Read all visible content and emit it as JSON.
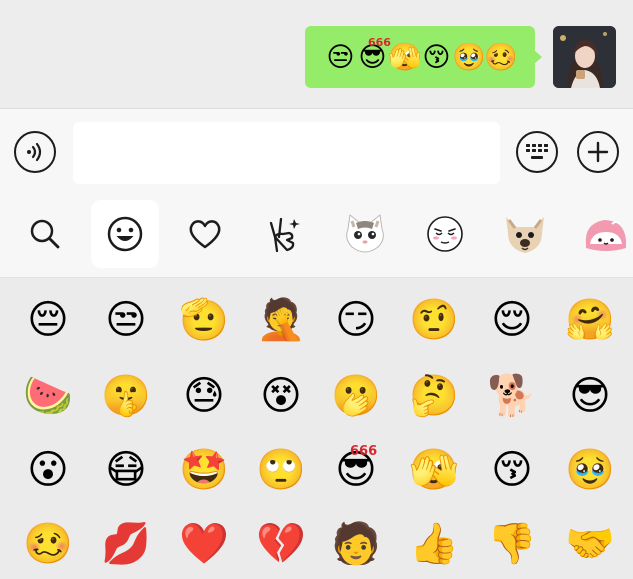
{
  "chat": {
    "message_emojis": [
      "😒",
      "😎",
      "🫣",
      "😚",
      "🥹",
      "🥴"
    ],
    "bubble_color": "#95ec69",
    "message_badge": "666"
  },
  "input_bar": {
    "voice_icon": "voice-icon",
    "text_value": "",
    "keyboard_icon": "keyboard-icon",
    "plus_icon": "plus-icon"
  },
  "tabs": [
    {
      "name": "search",
      "glyph": ""
    },
    {
      "name": "smiley",
      "glyph": ""
    },
    {
      "name": "favorites",
      "glyph": ""
    },
    {
      "name": "gestures",
      "glyph": ""
    },
    {
      "name": "cat-sticker",
      "glyph": "🐱"
    },
    {
      "name": "face-sticker",
      "glyph": ""
    },
    {
      "name": "dog-sticker",
      "glyph": "🐶"
    },
    {
      "name": "pink-sticker",
      "glyph": "🐷"
    }
  ],
  "emoji_rows": [
    [
      "😔",
      "😒",
      "🫡",
      "🤦",
      "😏",
      "🤨",
      "😌",
      "🤗"
    ],
    [
      "🍉",
      "🤫",
      "😓",
      "😵",
      "🫢",
      "🤔",
      "🐕",
      "😎"
    ],
    [
      "😮",
      "😷",
      "🤩",
      "🙄",
      "😎",
      "🫣",
      "😚",
      "🥹"
    ],
    [
      "🥴",
      "💋",
      "❤️",
      "💔",
      "🧑",
      "👍",
      "👎",
      "🤝"
    ]
  ],
  "grid_badge": "666"
}
